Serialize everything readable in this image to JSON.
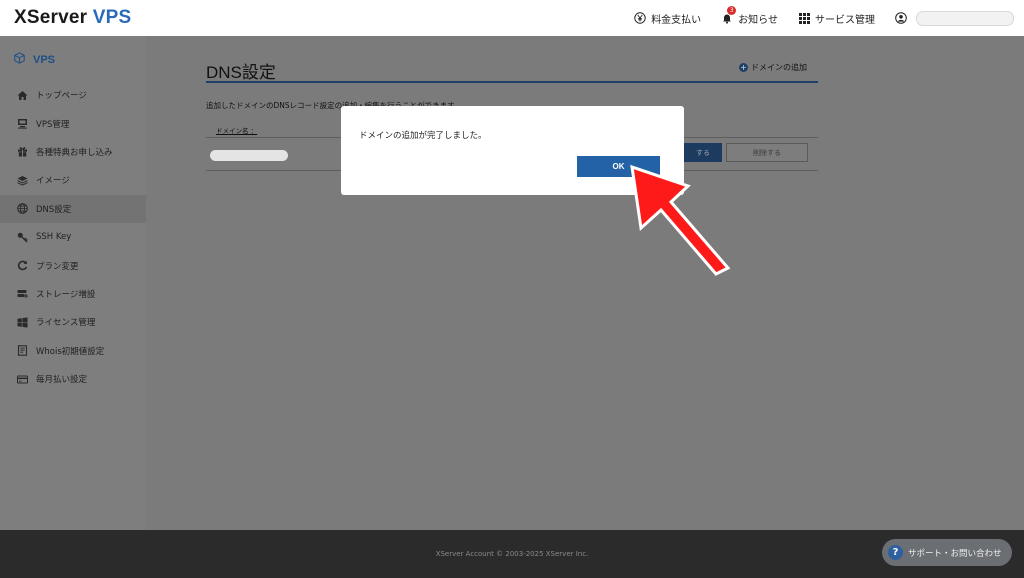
{
  "app": {
    "logo_main": "XServer",
    "logo_sub": "VPS"
  },
  "topnav": {
    "payment": "料金支払い",
    "notifications": "お知らせ",
    "notification_count": "3",
    "services": "サービス管理"
  },
  "sidebar": {
    "title": "VPS",
    "items": [
      {
        "label": "トップページ",
        "icon": "home-icon"
      },
      {
        "label": "VPS管理",
        "icon": "server-icon"
      },
      {
        "label": "各種特典お申し込み",
        "icon": "gift-icon"
      },
      {
        "label": "イメージ",
        "icon": "layers-icon"
      },
      {
        "label": "DNS設定",
        "icon": "globe-icon"
      },
      {
        "label": "SSH Key",
        "icon": "key-icon"
      },
      {
        "label": "プラン変更",
        "icon": "refresh-icon"
      },
      {
        "label": "ストレージ増設",
        "icon": "storage-icon"
      },
      {
        "label": "ライセンス管理",
        "icon": "windows-icon"
      },
      {
        "label": "Whois初期値設定",
        "icon": "document-icon"
      },
      {
        "label": "毎月払い設定",
        "icon": "card-icon"
      }
    ],
    "active_index": 4
  },
  "main": {
    "page_title": "DNS設定",
    "add_domain": "ドメインの追加",
    "description": "追加したドメインのDNSレコード設定の追加・編集を行うことができます。",
    "table": {
      "header_domain": "ドメイン名 ：",
      "edit_button": "する",
      "delete_button": "削除する"
    }
  },
  "modal": {
    "message": "ドメインの追加が完了しました。",
    "ok_label": "OK"
  },
  "footer": {
    "copyright": "XServer Account © 2003-2025 XServer Inc.",
    "support": "サポート・お問い合わせ"
  },
  "colors": {
    "brand_blue": "#2a6bb8",
    "primary_button": "#2362a6",
    "annotation_arrow": "#ff1a1a"
  }
}
